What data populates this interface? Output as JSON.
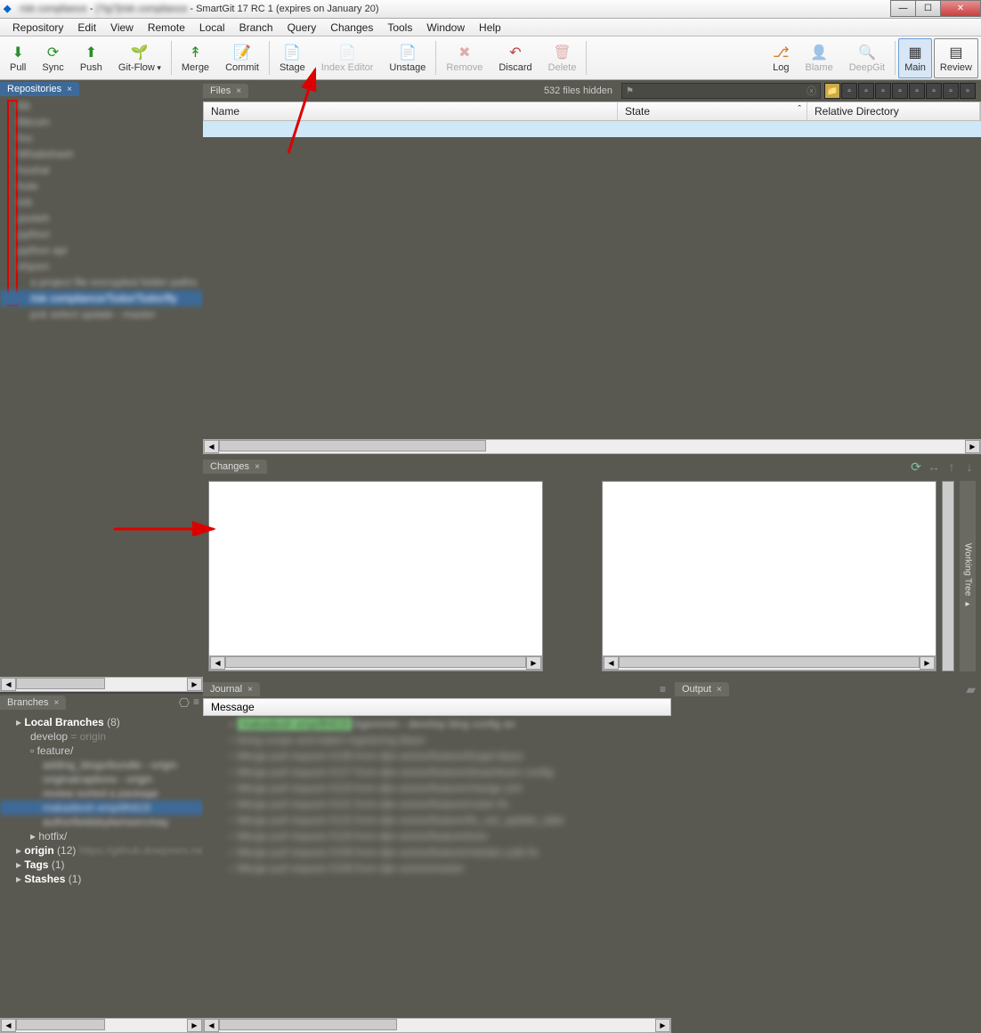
{
  "title": {
    "blur1": "risk compliance",
    "blur2": "[?ig?]risk compliance",
    "main": "SmartGit 17 RC 1 (expires on January 20)"
  },
  "menu": [
    "Repository",
    "Edit",
    "View",
    "Remote",
    "Local",
    "Branch",
    "Query",
    "Changes",
    "Tools",
    "Window",
    "Help"
  ],
  "toolbar": [
    {
      "id": "pull",
      "label": "Pull",
      "icon": "⬇",
      "color": "#2a8f2a"
    },
    {
      "id": "sync",
      "label": "Sync",
      "icon": "⟳",
      "color": "#2a8f2a"
    },
    {
      "id": "push",
      "label": "Push",
      "icon": "⬆",
      "color": "#2a8f2a"
    },
    {
      "id": "gitflow",
      "label": "Git-Flow",
      "icon": "🌱",
      "color": "#2a8f2a",
      "dropdown": true
    },
    {
      "sep": true
    },
    {
      "id": "merge",
      "label": "Merge",
      "icon": "↟",
      "color": "#2a8f2a"
    },
    {
      "id": "commit",
      "label": "Commit",
      "icon": "📝",
      "color": "#d08030"
    },
    {
      "sep": true
    },
    {
      "id": "stage",
      "label": "Stage",
      "icon": "📄",
      "color": "#d08030"
    },
    {
      "id": "indexeditor",
      "label": "Index Editor",
      "icon": "📄",
      "color": "#d08030",
      "disabled": true
    },
    {
      "id": "unstage",
      "label": "Unstage",
      "icon": "📄",
      "color": "#d08030"
    },
    {
      "sep": true
    },
    {
      "id": "remove",
      "label": "Remove",
      "icon": "✖",
      "color": "#c04040",
      "disabled": true
    },
    {
      "id": "discard",
      "label": "Discard",
      "icon": "↶",
      "color": "#c04040"
    },
    {
      "id": "delete",
      "label": "Delete",
      "icon": "🗑",
      "color": "#c04040",
      "disabled": true
    },
    {
      "sep": true
    },
    {
      "spacer": true
    },
    {
      "id": "log",
      "label": "Log",
      "icon": "⎇",
      "color": "#d08030"
    },
    {
      "id": "blame",
      "label": "Blame",
      "icon": "👤",
      "color": "#888",
      "disabled": true
    },
    {
      "id": "deepgit",
      "label": "DeepGit",
      "icon": "🔍",
      "color": "#888",
      "disabled": true
    },
    {
      "sep": true
    },
    {
      "id": "main",
      "label": "Main",
      "icon": "▦",
      "perspective": true,
      "active": true
    },
    {
      "id": "review",
      "label": "Review",
      "icon": "▤",
      "perspective": true
    }
  ],
  "panels": {
    "repositories": "Repositories",
    "files": "Files",
    "changes": "Changes",
    "branches": "Branches",
    "journal": "Journal",
    "output": "Output",
    "workingTree": "Working Tree"
  },
  "filesHidden": "532 files hidden",
  "columns": {
    "name": "Name",
    "state": "State",
    "reldir": "Relative Directory"
  },
  "branches": {
    "local": "Local Branches",
    "localCount": "(8)",
    "develop": "develop",
    "developEq": " = origin",
    "feature": "feature/",
    "hotfix": "hotfix/",
    "origin": "origin",
    "originCount": "(12)",
    "originUrl": "https://github.dowjones.ne",
    "tags": "Tags",
    "tagsCount": "(1)",
    "stashes": "Stashes",
    "stashesCount": "(1)"
  },
  "journal": {
    "message": "Message"
  },
  "searchPlaceholder": ""
}
